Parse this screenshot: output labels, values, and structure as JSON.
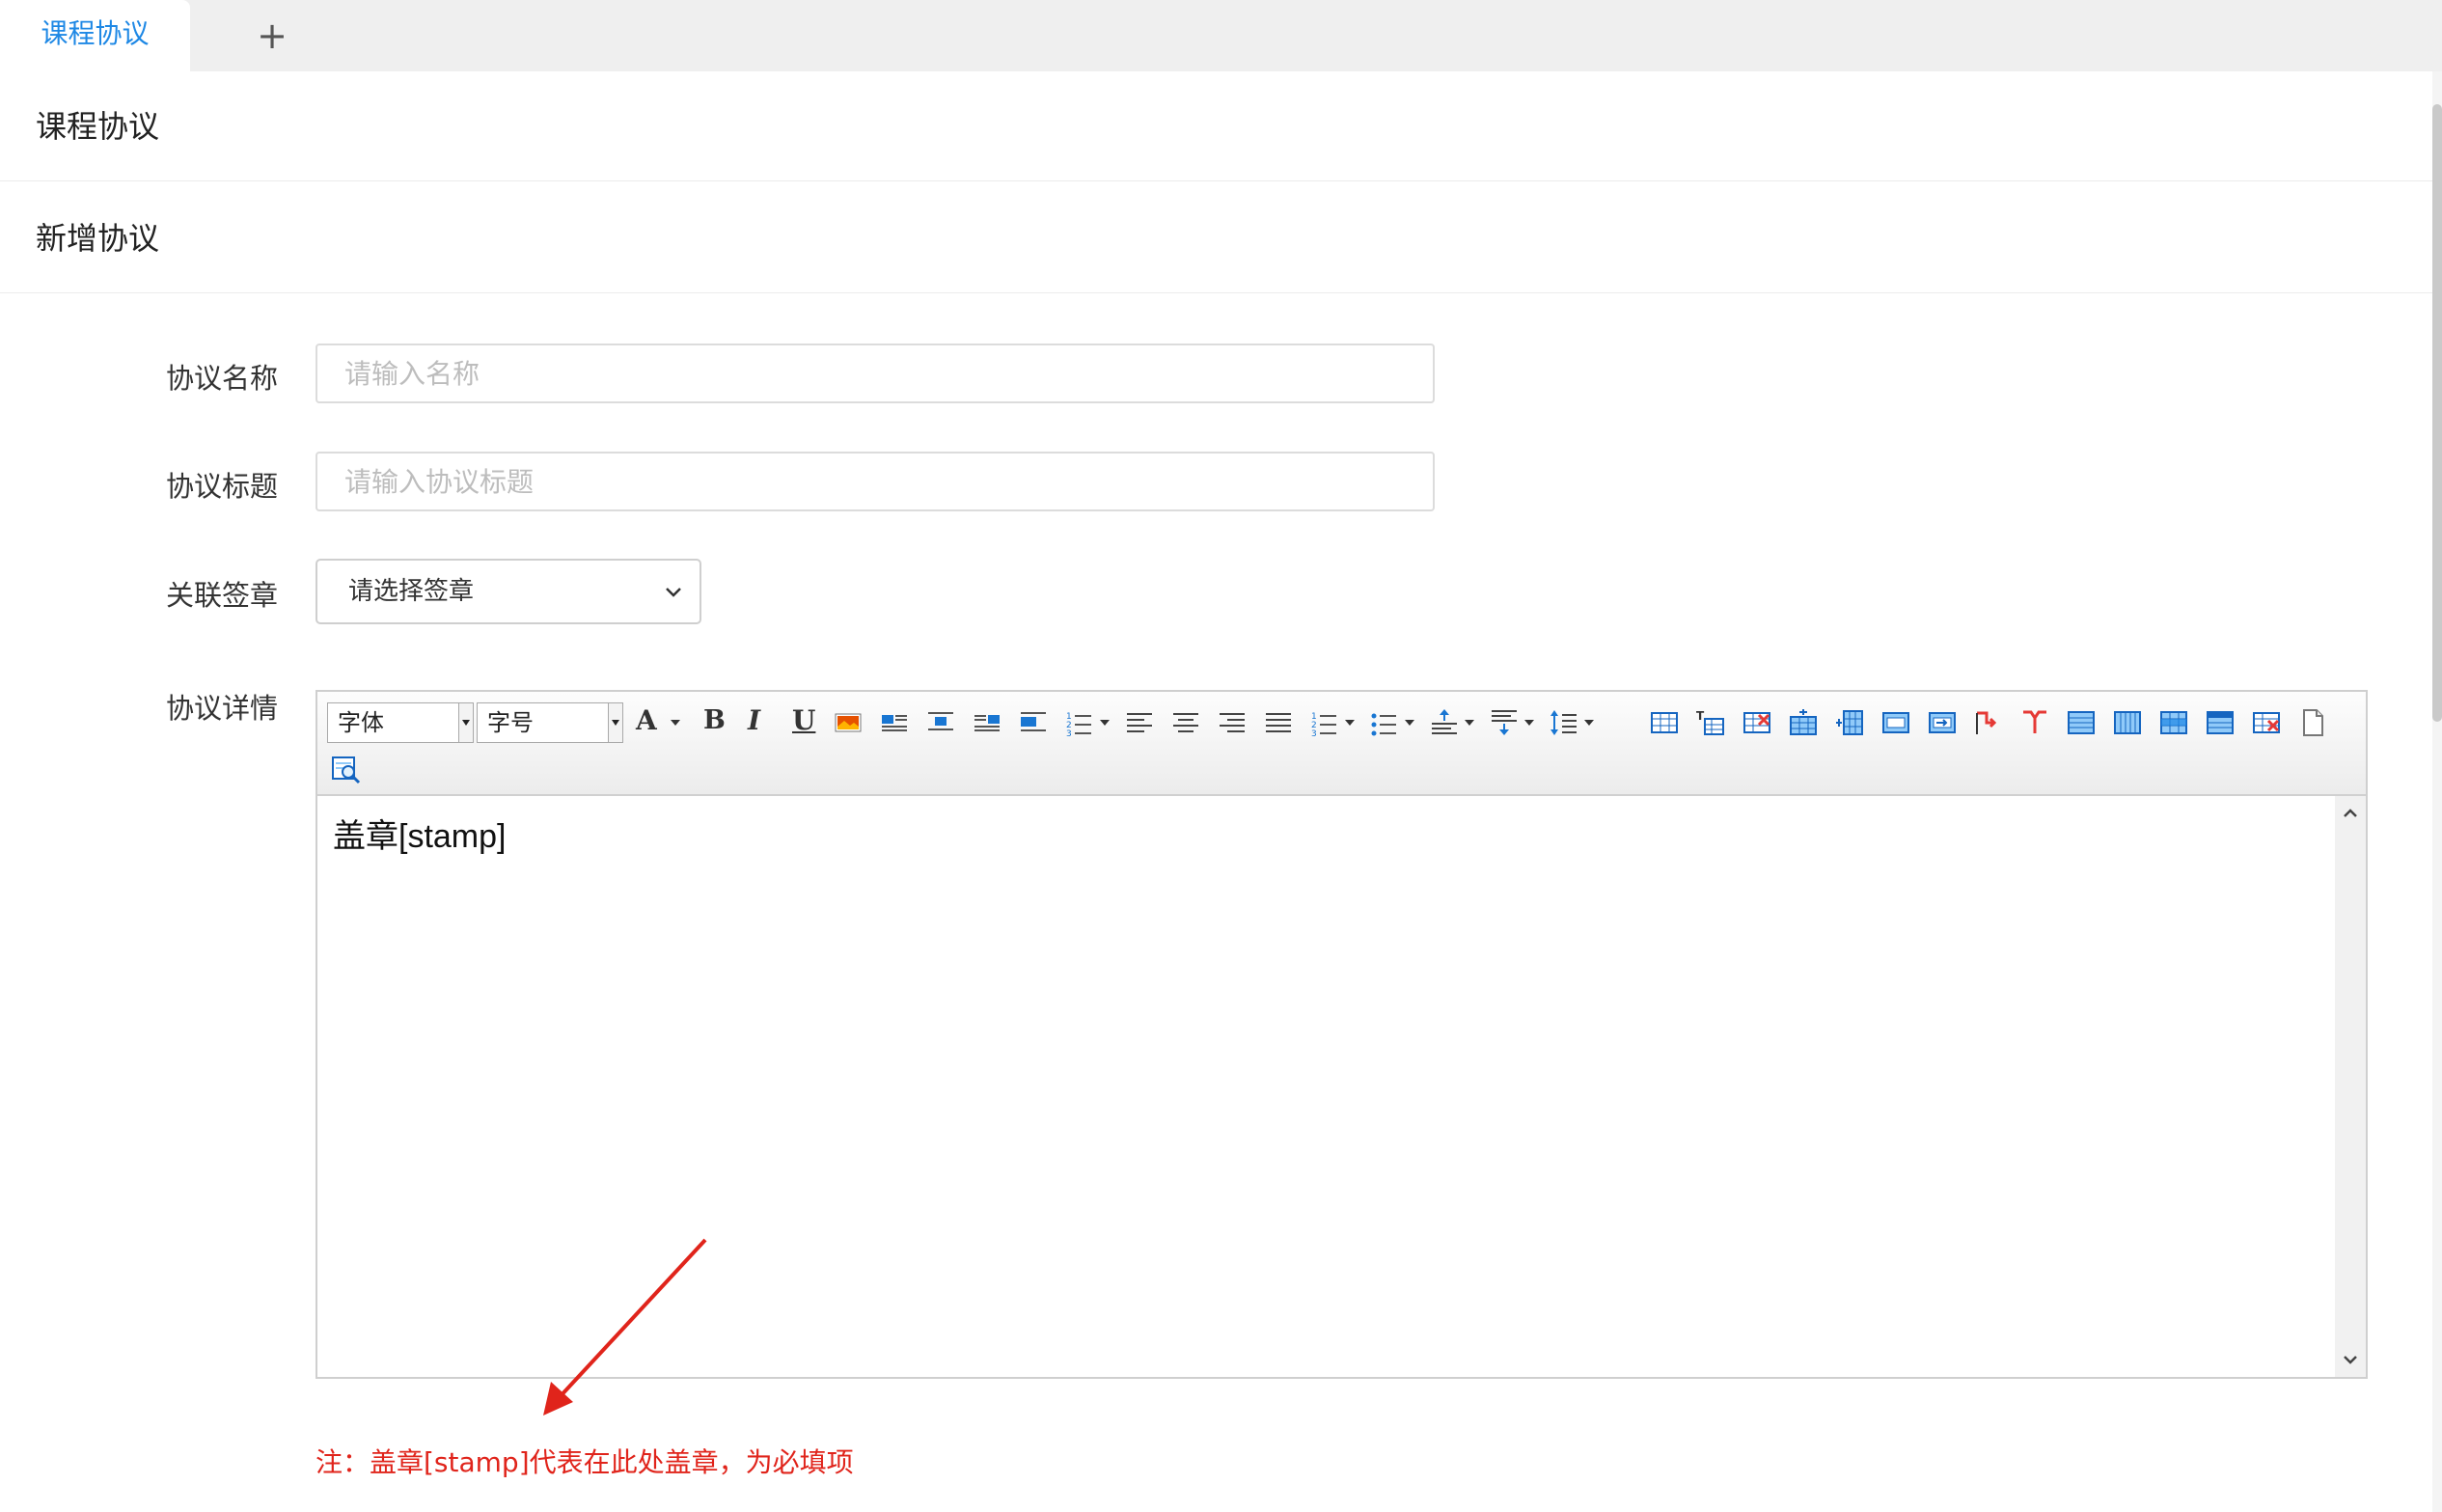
{
  "tabs": {
    "active_label": "课程协议",
    "add_symbol": "+"
  },
  "sections": {
    "page_title": "课程协议",
    "form_title": "新增协议"
  },
  "form": {
    "name_label": "协议名称",
    "name_placeholder": "请输入名称",
    "title_label": "协议标题",
    "title_placeholder": "请输入协议标题",
    "stamp_label": "关联签章",
    "stamp_select_value": "请选择签章",
    "detail_label": "协议详情"
  },
  "editor": {
    "font_family_label": "字体",
    "font_size_label": "字号",
    "bold": "B",
    "italic": "I",
    "underline": "U",
    "forecolor": "A",
    "content": "盖章[stamp]",
    "toolbar_icons": [
      "forecolor-icon",
      "bold-icon",
      "italic-icon",
      "underline-icon",
      "insert-image-icon",
      "image-left-icon",
      "image-center-icon",
      "image-right-icon",
      "image-none-icon",
      "ordered-list-icon",
      "align-left-icon",
      "align-center-icon",
      "align-right-icon",
      "align-justify-icon",
      "ordered-list-2-icon",
      "unordered-list-icon",
      "row-spacing-top-icon",
      "row-spacing-bottom-icon",
      "line-height-icon",
      "insert-table-icon",
      "insert-title-icon",
      "delete-table-icon",
      "insert-row-before-icon",
      "insert-col-before-icon",
      "merge-cells-icon",
      "merge-right-icon",
      "merge-down-icon",
      "split-cells-icon",
      "split-to-rows-icon",
      "split-to-cols-icon",
      "insert-row-icon",
      "insert-col-icon",
      "delete-row-icon",
      "delete-col-icon",
      "new-page-icon",
      "preview-icon"
    ]
  },
  "note": {
    "text": "注：盖章[stamp]代表在此处盖章，为必填项",
    "color": "#e0241b"
  },
  "colors": {
    "accent": "#1e88e5",
    "annotation": "#e0241b"
  }
}
